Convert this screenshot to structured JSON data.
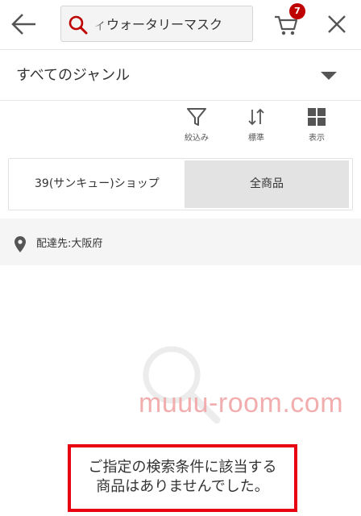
{
  "header": {
    "search_query": "ィウォータリーマスク",
    "cart_count": "7"
  },
  "genre": {
    "label": "すべてのジャンル"
  },
  "toolbar": {
    "filter_label": "絞込み",
    "sort_label": "標準",
    "view_label": "表示"
  },
  "scope": {
    "shop_label": "39(サンキュー)ショップ",
    "all_label": "全商品"
  },
  "delivery": {
    "text": "配達先:大阪府"
  },
  "watermark": {
    "text": "muuu-room.com"
  },
  "notice": {
    "line1": "ご指定の検索条件に該当する",
    "line2": "商品はありませんでした。"
  },
  "colors": {
    "brand_red": "#bf0000",
    "highlight_border": "#e60012",
    "watermark": "#f1a8a8"
  }
}
